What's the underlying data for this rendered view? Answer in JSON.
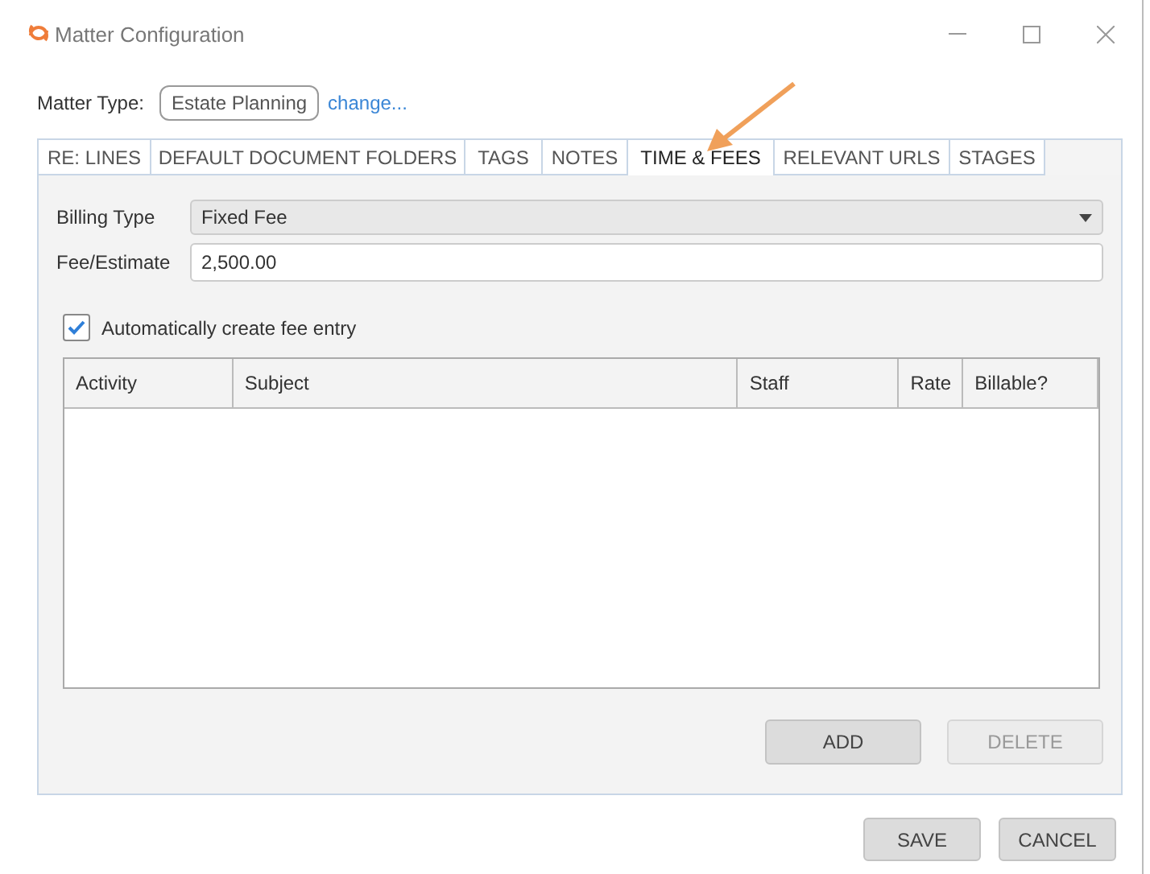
{
  "window": {
    "title": "Matter Configuration"
  },
  "matter_type": {
    "label": "Matter Type:",
    "value": "Estate Planning",
    "link": "change..."
  },
  "tabs": [
    {
      "label": "RE: LINES",
      "selected": false
    },
    {
      "label": "DEFAULT DOCUMENT FOLDERS",
      "selected": false
    },
    {
      "label": "TAGS",
      "selected": false
    },
    {
      "label": "NOTES",
      "selected": false
    },
    {
      "label": "TIME & FEES",
      "selected": true
    },
    {
      "label": "RELEVANT URLS",
      "selected": false
    },
    {
      "label": "STAGES",
      "selected": false
    }
  ],
  "billing_type": {
    "label": "Billing Type",
    "value": "Fixed Fee"
  },
  "fee_estimate": {
    "label": "Fee/Estimate",
    "value": "2,500.00"
  },
  "auto_fee_entry": {
    "label": "Automatically create fee entry",
    "checked": true
  },
  "table": {
    "columns": [
      "Activity",
      "Subject",
      "Staff",
      "Rate",
      "Billable?"
    ]
  },
  "table_buttons": [
    {
      "label": "ADD",
      "disabled": false
    },
    {
      "label": "DELETE",
      "disabled": true
    }
  ],
  "dialog_buttons": [
    {
      "label": "SAVE",
      "disabled": false
    },
    {
      "label": "CANCEL",
      "disabled": false
    }
  ]
}
